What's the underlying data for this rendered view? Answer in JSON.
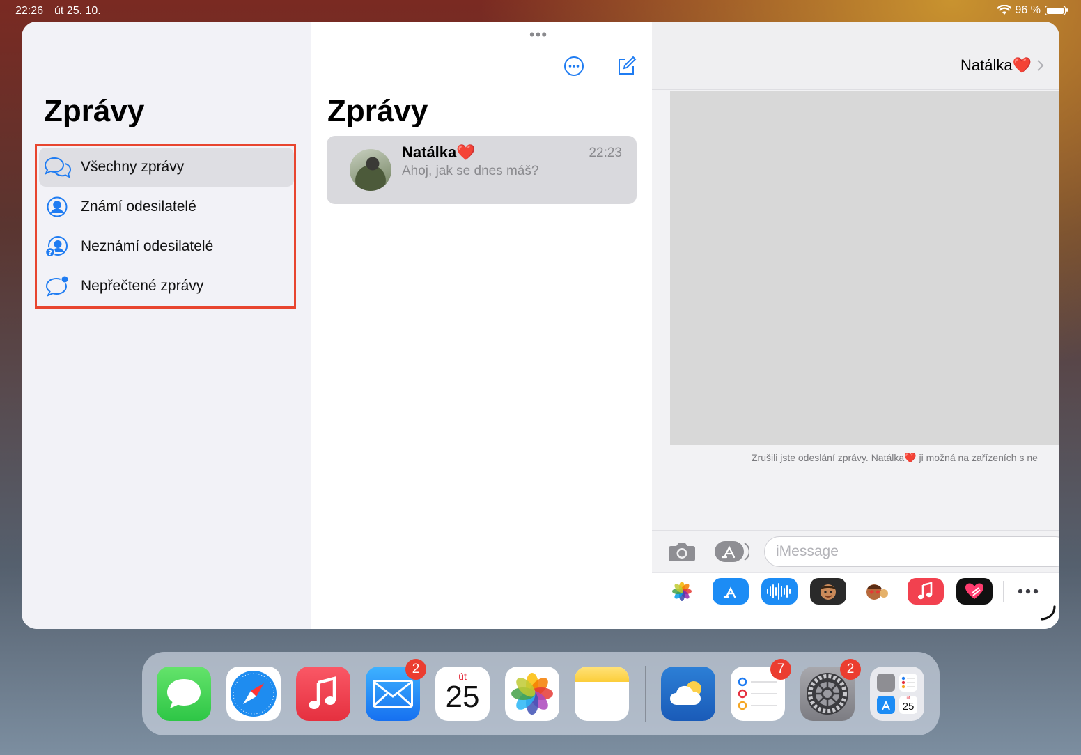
{
  "status_bar": {
    "time": "22:26",
    "date": "út 25. 10.",
    "battery": "96 %",
    "battery_level": 0.96
  },
  "sidebar": {
    "title": "Zprávy",
    "filters": [
      {
        "label": "Všechny zprávy",
        "icon": "bubbles-icon",
        "selected": true
      },
      {
        "label": "Známí odesilatelé",
        "icon": "person-circle-icon"
      },
      {
        "label": "Neznámí odesilatelé",
        "icon": "person-question-icon"
      },
      {
        "label": "Nepřečtené zprávy",
        "icon": "bubble-unread-icon"
      }
    ],
    "highlight_color": "#e8452f"
  },
  "list": {
    "title": "Zprávy",
    "more_icon": "ellipsis-circle-icon",
    "compose_icon": "compose-icon",
    "conversations": [
      {
        "name": "Natálka❤️",
        "time": "22:23",
        "preview": "Ahoj, jak se dnes máš?"
      }
    ]
  },
  "detail": {
    "contact_name": "Natálka❤️",
    "notice": "Zrušili jste odeslání zprávy. Natálka❤️ ji možná na zařízeních s ne",
    "composer": {
      "placeholder": "iMessage"
    },
    "apps": [
      "photos-icon",
      "appstore-icon",
      "audio-icon",
      "memoji-icon",
      "stickers-icon",
      "music-icon",
      "digital-touch-icon",
      "more-icon"
    ]
  },
  "dock": {
    "apps": [
      {
        "name": "messages-icon"
      },
      {
        "name": "safari-icon"
      },
      {
        "name": "music-icon"
      },
      {
        "name": "mail-icon",
        "badge": "2"
      },
      {
        "name": "calendar-icon",
        "day_name": "út",
        "day": "25"
      },
      {
        "name": "photos-icon"
      },
      {
        "name": "notes-icon"
      },
      {
        "name": "weather-icon"
      },
      {
        "name": "reminders-icon",
        "badge": "7"
      },
      {
        "name": "settings-icon",
        "badge": "2"
      },
      {
        "name": "recent-apps-folder-icon",
        "mini_day": "25",
        "mini_day_name": "út"
      }
    ]
  },
  "accent_color": "#1f7cf2"
}
